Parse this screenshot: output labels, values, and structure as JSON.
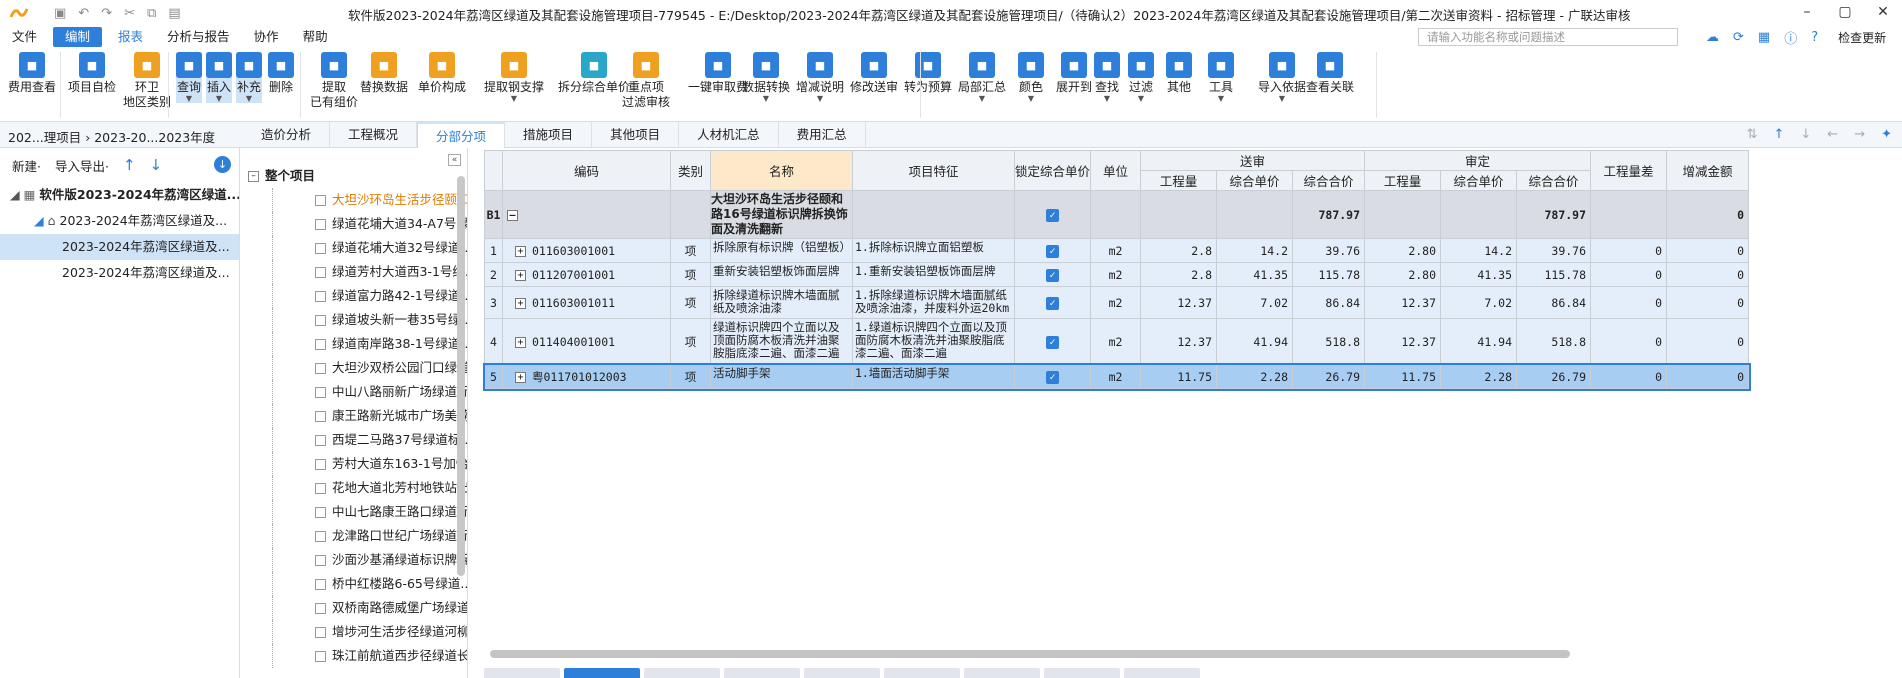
{
  "app": {
    "title": "软件版2023-2024年荔湾区绿道及其配套设施管理项目-779545 - E:/Desktop/2023-2024年荔湾区绿道及其配套设施管理项目/（待确认2）2023-2024年荔湾区绿道及其配套设施管理项目/第二次送审资料 - 招标管理 - 广联达审核"
  },
  "menu": {
    "items": [
      "文件",
      "编制",
      "报表",
      "分析与报告",
      "协作",
      "帮助"
    ],
    "search_placeholder": "请输入功能名称或问题描述",
    "check_label": "检查更新"
  },
  "ribbon": {
    "buttons": [
      {
        "label": "费用查看",
        "icon": "fee-view-icon"
      },
      {
        "label": "项目自检",
        "icon": "self-check-icon"
      },
      {
        "label": "环卫\n地区类别",
        "icon": "sanitation-icon"
      },
      {
        "label": "查询",
        "icon": "query-icon"
      },
      {
        "label": "插入",
        "icon": "insert-icon"
      },
      {
        "label": "补充",
        "icon": "supplement-icon"
      },
      {
        "label": "删除",
        "icon": "delete-icon"
      },
      {
        "label": "提取\n已有组价",
        "icon": "extract-icon"
      },
      {
        "label": "替换数据",
        "icon": "replace-icon"
      },
      {
        "label": "单价构成",
        "icon": "unit-price-icon"
      },
      {
        "label": "提取钢支撑",
        "icon": "steel-support-icon"
      },
      {
        "label": "拆分综合单价",
        "icon": "split-price-icon"
      },
      {
        "label": "重点项\n过滤审核",
        "icon": "filter-audit-icon"
      },
      {
        "label": "一键审取费",
        "icon": "one-key-fee-icon"
      },
      {
        "label": "数据转换",
        "icon": "data-convert-icon"
      },
      {
        "label": "增减说明",
        "icon": "change-note-icon"
      },
      {
        "label": "修改送审",
        "icon": "modify-submit-icon"
      },
      {
        "label": "转为预算",
        "icon": "to-budget-icon"
      },
      {
        "label": "局部汇总",
        "icon": "partial-sum-icon"
      },
      {
        "label": "颜色",
        "icon": "color-icon"
      },
      {
        "label": "展开到",
        "icon": "expand-to-icon"
      },
      {
        "label": "查找",
        "icon": "find-icon"
      },
      {
        "label": "过滤",
        "icon": "filter-icon"
      },
      {
        "label": "其他",
        "icon": "other-icon"
      },
      {
        "label": "工具",
        "icon": "tools-icon"
      },
      {
        "label": "导入依据",
        "icon": "import-basis-icon"
      },
      {
        "label": "查看关联",
        "icon": "view-relation-icon"
      }
    ]
  },
  "breadcrumb": "202...理项目 › 2023-20...2023年度",
  "tabs": [
    "造价分析",
    "工程概况",
    "分部分项",
    "措施项目",
    "其他项目",
    "人材机汇总",
    "费用汇总"
  ],
  "left": {
    "new_label": "新建·",
    "import_label": "导入导出·",
    "tree": [
      "软件版2023-2024年荔湾区绿道...",
      "2023-2024年荔湾区绿道及...",
      "2023-2024年荔湾区绿道及...",
      "2023-2024年荔湾区绿道及..."
    ]
  },
  "mid": {
    "root": "整个项目",
    "items": [
      "大坦沙环岛生活步径颐和...",
      "绿道花埔大道34-A7号绿...",
      "绿道花埔大道32号绿道...",
      "绿道芳村大道西3-1号绿...",
      "绿道富力路42-1号绿道...",
      "绿道坡头新一巷35号绿...",
      "绿道南岸路38-1号绿道...",
      "大坦沙双桥公园门口绿道...",
      "中山八路丽新广场绿道标...",
      "康王路新光城市广场美荔...",
      "西堤二马路37号绿道标...",
      "芳村大道东163-1号加怡...",
      "花地大道北芳村地铁站出...",
      "中山七路康王路口绿道标...",
      "龙津路口世纪广场绿道标...",
      "沙面沙基涌绿道标识牌拆...",
      "桥中红楼路6-65号绿道...",
      "双桥南路德威堡广场绿道...",
      "增埗河生活步径绿道河柳...",
      "珠江前航道西步径绿道长..."
    ]
  },
  "grid": {
    "headers": {
      "code": "编码",
      "type": "类别",
      "name": "名称",
      "feature": "项目特征",
      "lock": "锁定综合单价",
      "unit": "单位",
      "submit": "送审",
      "approve": "审定",
      "qty": "工程量",
      "uprice": "综合单价",
      "total": "综合合价",
      "qty_diff": "工程量差",
      "inc_amount": "增减金额"
    },
    "b1": {
      "idx": "B1",
      "name": "大坦沙环岛生活步径颐和路16号绿道标识牌拆换饰面及清洗翻新",
      "submit_total": "787.97",
      "approve_total": "787.97",
      "inc": "0"
    },
    "rows": [
      {
        "idx": "1",
        "code": "011603001001",
        "type": "项",
        "name": "拆除原有标识牌（铝塑板）",
        "feature": "1.拆除标识牌立面铝塑板",
        "unit": "m2",
        "sq": "2.8",
        "sp": "14.2",
        "st": "39.76",
        "aq": "2.80",
        "ap": "14.2",
        "at": "39.76",
        "diff": "0",
        "inc": "0"
      },
      {
        "idx": "2",
        "code": "011207001001",
        "type": "项",
        "name": "重新安装铝塑板饰面层牌",
        "feature": "1.重新安装铝塑板饰面层牌",
        "unit": "m2",
        "sq": "2.8",
        "sp": "41.35",
        "st": "115.78",
        "aq": "2.80",
        "ap": "41.35",
        "at": "115.78",
        "diff": "0",
        "inc": "0"
      },
      {
        "idx": "3",
        "code": "011603001011",
        "type": "项",
        "name": "拆除绿道标识牌木墙面腻纸及喷涂油漆",
        "feature": "1.拆除绿道标识牌木墙面腻纸及喷涂油漆，并废料外运20km",
        "unit": "m2",
        "sq": "12.37",
        "sp": "7.02",
        "st": "86.84",
        "aq": "12.37",
        "ap": "7.02",
        "at": "86.84",
        "diff": "0",
        "inc": "0"
      },
      {
        "idx": "4",
        "code": "011404001001",
        "type": "项",
        "name": "绿道标识牌四个立面以及顶面防腐木板清洗并油聚胺脂底漆二遍、面漆二遍",
        "feature": "1.绿道标识牌四个立面以及顶面防腐木板清洗并油聚胺脂底漆二遍、面漆二遍",
        "unit": "m2",
        "sq": "12.37",
        "sp": "41.94",
        "st": "518.8",
        "aq": "12.37",
        "ap": "41.94",
        "at": "518.8",
        "diff": "0",
        "inc": "0"
      },
      {
        "idx": "5",
        "code": "粤011701012003",
        "type": "项",
        "name": "活动脚手架",
        "feature": "1.墙面活动脚手架",
        "unit": "m2",
        "sq": "11.75",
        "sp": "2.28",
        "st": "26.79",
        "aq": "11.75",
        "ap": "2.28",
        "at": "26.79",
        "diff": "0",
        "inc": "0"
      }
    ]
  }
}
